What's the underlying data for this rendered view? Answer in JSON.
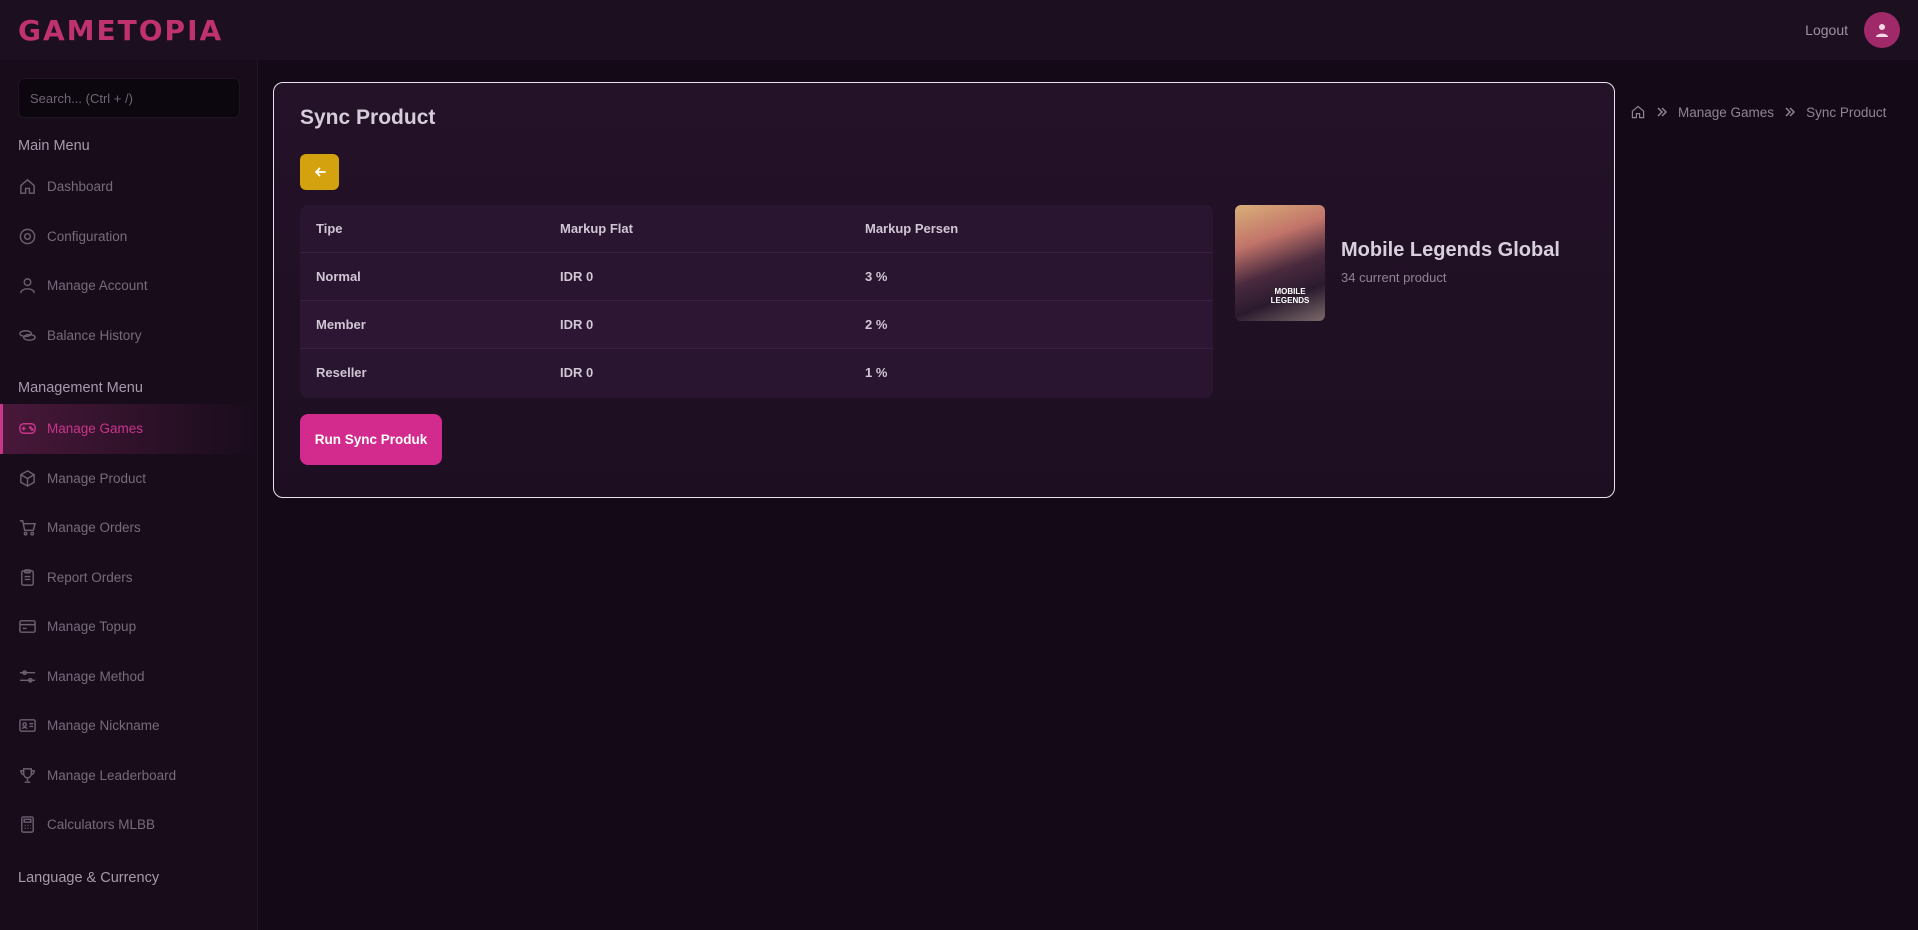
{
  "header": {
    "logo": "GAMETOPIA",
    "logout_label": "Logout"
  },
  "sidebar": {
    "search_placeholder": "Search... (Ctrl + /)",
    "main_menu_title": "Main Menu",
    "main_items": [
      {
        "label": "Dashboard",
        "icon": "home-icon"
      },
      {
        "label": "Configuration",
        "icon": "gear-icon"
      },
      {
        "label": "Manage Account",
        "icon": "user-icon"
      },
      {
        "label": "Balance History",
        "icon": "coins-icon"
      }
    ],
    "management_menu_title": "Management Menu",
    "management_items": [
      {
        "label": "Manage Games",
        "icon": "gamepad-icon",
        "active": true
      },
      {
        "label": "Manage Product",
        "icon": "box-icon"
      },
      {
        "label": "Manage Orders",
        "icon": "cart-icon"
      },
      {
        "label": "Report Orders",
        "icon": "clipboard-icon"
      },
      {
        "label": "Manage Topup",
        "icon": "card-icon"
      },
      {
        "label": "Manage Method",
        "icon": "sliders-icon"
      },
      {
        "label": "Manage Nickname",
        "icon": "id-card-icon"
      },
      {
        "label": "Manage Leaderboard",
        "icon": "trophy-icon"
      },
      {
        "label": "Calculators MLBB",
        "icon": "calculator-icon"
      }
    ],
    "language_title": "Language & Currency"
  },
  "main": {
    "title": "Sync Product",
    "table": {
      "headers": [
        "Tipe",
        "Markup Flat",
        "Markup Persen"
      ],
      "rows": [
        [
          "Normal",
          "IDR 0",
          "3 %"
        ],
        [
          "Member",
          "IDR 0",
          "2 %"
        ],
        [
          "Reseller",
          "IDR 0",
          "1 %"
        ]
      ]
    },
    "game": {
      "name": "Mobile Legends Global",
      "subtitle": "34 current product",
      "thumb_text": "MOBILE LEGENDS"
    },
    "sync_button_label": "Run Sync Produk"
  },
  "breadcrumb": {
    "items": [
      "Manage Games",
      "Sync Product"
    ]
  },
  "colors": {
    "accent": "#d22a8d",
    "back_button": "#d4a20f",
    "background": "#140a17"
  }
}
